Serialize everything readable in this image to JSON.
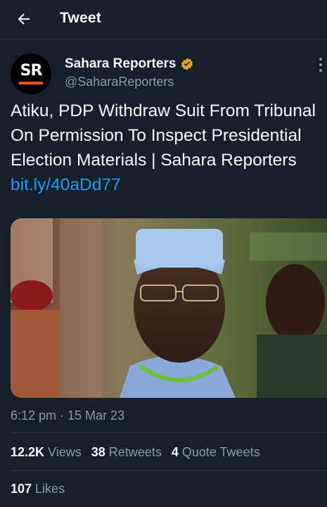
{
  "header": {
    "title": "Tweet",
    "back_icon": "arrow-left-icon"
  },
  "tweet": {
    "author": {
      "avatar_text": "SR",
      "display_name": "Sahara Reporters",
      "handle": "@SaharaReporters",
      "verified_icon": "verified-badge-icon",
      "verified_color": "#e8a317"
    },
    "text": "Atiku, PDP Withdraw Suit From Tribunal On Permission To Inspect Presidential Election Materials | Sahara Reporters ",
    "link": "bit.ly/40aDd77",
    "timestamp": "6:12 pm · 15 Mar 23",
    "stats": {
      "views_count": "12.2K",
      "views_label": "Views",
      "retweets_count": "38",
      "retweets_label": "Retweets",
      "quotes_count": "4",
      "quotes_label": "Quote Tweets",
      "likes_count": "107",
      "likes_label": "Likes"
    }
  },
  "colors": {
    "background": "#15202b",
    "link": "#1d9bf0",
    "secondary_text": "#8b98a5",
    "brand_orange": "#e8541d"
  }
}
